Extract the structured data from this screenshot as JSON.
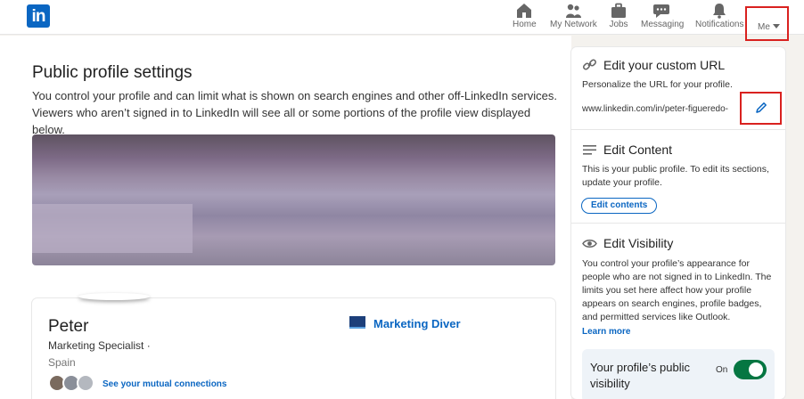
{
  "nav": {
    "logo": "in",
    "home": "Home",
    "network": "My Network",
    "jobs": "Jobs",
    "messaging": "Messaging",
    "notifications": "Notifications",
    "me": "Me"
  },
  "main": {
    "title": "Public profile settings",
    "description": "You control your profile and can limit what is shown on search engines and other off-LinkedIn services. Viewers who aren’t signed in to LinkedIn will see all or some portions of the profile view displayed below.",
    "profile": {
      "name": "Peter",
      "headline": "Marketing Specialist ·",
      "location": "Spain",
      "mutual_link": "See your mutual connections",
      "company": "Marketing Diver"
    }
  },
  "sidebar": {
    "url_section": {
      "title": "Edit your custom URL",
      "text": "Personalize the URL for your profile.",
      "url": "www.linkedin.com/in/peter-figueredo-"
    },
    "content_section": {
      "title": "Edit Content",
      "text": "This is your public profile. To edit its sections, update your profile.",
      "button": "Edit contents"
    },
    "visibility_section": {
      "title": "Edit Visibility",
      "text": "You control your profile’s appearance for people who are not signed in to LinkedIn. The limits you set here affect how your profile appears on search engines, profile badges, and permitted services like Outlook.",
      "learn_more": "Learn more",
      "toggle_label": "Your profile’s public visibility",
      "toggle_state": "On"
    }
  },
  "colors": {
    "brand": "#0a66c2",
    "highlight": "#d9211f",
    "toggle_on": "#057642"
  }
}
